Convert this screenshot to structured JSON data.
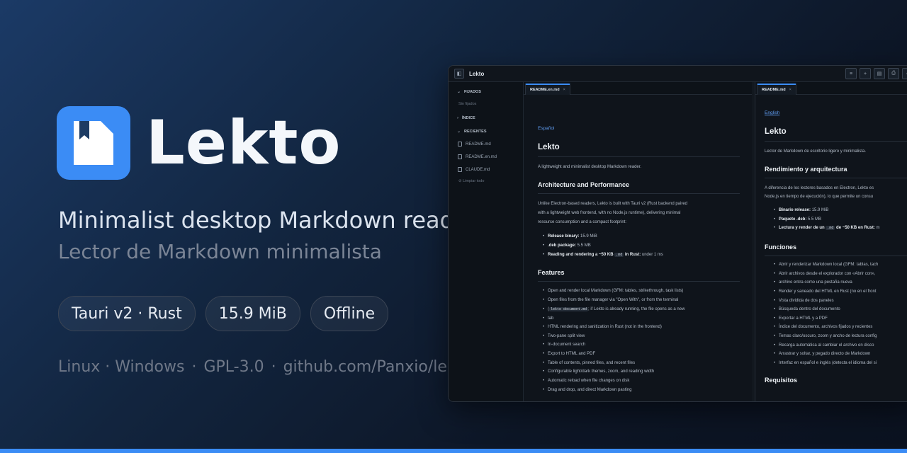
{
  "hero": {
    "app_name": "Lekto",
    "tagline_en": "Minimalist desktop Markdown reader",
    "tagline_es": "Lector de Markdown minimalista",
    "badges": [
      "Tauri v2 · Rust",
      "15.9 MiB",
      "Offline"
    ],
    "footer": {
      "platforms": "Linux · Windows",
      "license": "GPL-3.0",
      "repo": "github.com/Panxio/lekto"
    }
  },
  "window": {
    "title": "Lekto",
    "sidebar": {
      "pinned_label": "FIJADOS",
      "pinned_empty": "Sin fijados",
      "index_label": "ÍNDICE",
      "recent_label": "RECIENTES",
      "recent_files": [
        "README.md",
        "README.en.md",
        "CLAUDE.md"
      ],
      "clear_all": "Limpiar todo"
    },
    "pane_left": {
      "tab": "README.en.md",
      "lang_link": "Español",
      "h1": "Lekto",
      "intro": "A lightweight and minimalist desktop Markdown reader.",
      "h2_arch": "Architecture and Performance",
      "arch_p1": "Unlike Electron-based readers, Lekto is built with Tauri v2 (Rust backend paired",
      "arch_p2": "with a lightweight web frontend, with no Node.js runtime), delivering minimal",
      "arch_p3": "resource consumption and a compact footprint:",
      "stats": [
        {
          "label": "Release binary:",
          "value": " 15.9 MiB"
        },
        {
          "label": ".deb package:",
          "value": " 5.5 MB"
        },
        {
          "label": "Reading and rendering a ~50 KB ",
          "code": ".md",
          "label2": " in Rust:",
          "value": " under 1 ms"
        }
      ],
      "h2_features": "Features",
      "features": [
        "Open and render local Markdown (GFM: tables, strikethrough, task lists)",
        "Open files from the file manager via \"Open With\", or from the terminal",
        "HTML rendering and sanitization in Rust (not in the frontend)",
        "Two-pane split view",
        "In-document search",
        "Export to HTML and PDF",
        "Table of contents, pinned files, and recent files",
        "Configurable light/dark themes, zoom, and reading width",
        "Automatic reload when file changes on disk",
        "Drag and drop, and direct Markdown pasting"
      ],
      "feature2_code": "lekto document.md",
      "feature2_tail": "; if Lekto is already running, the file opens as a new",
      "feature2_wrap": "tab"
    },
    "pane_right": {
      "tab": "README.md",
      "lang_link": "English",
      "h1": "Lekto",
      "intro": "Lector de Markdown de escritorio ligero y minimalista.",
      "h2_arch": "Rendimiento y arquitectura",
      "arch_p1": "A diferencia de los lectores basados en Electron, Lekto es",
      "arch_p2": "Node.js en tiempo de ejecución), lo que permite un consu",
      "stats": [
        {
          "label": "Binario release:",
          "value": " 15.9 MiB"
        },
        {
          "label": "Paquete .deb:",
          "value": " 5.5 MB"
        },
        {
          "label": "Lectura y render de un ",
          "code": ".md",
          "label2": " de ~50 KB en Rust:",
          "value": " m"
        }
      ],
      "h2_features": "Funciones",
      "features": [
        "Abrir y renderizar Markdown local (GFM: tablas, tach",
        "Abrir archivos desde el explorador con «Abrir con»,",
        "archivo entra como una pestaña nueva",
        "Render y saneado del HTML en Rust (no en el front",
        "Vista dividida de dos paneles",
        "Búsqueda dentro del documento",
        "Exportar a HTML y a PDF",
        "Índice del documento, archivos fijados y recientes",
        "Temas claro/oscuro, zoom y ancho de lectura config",
        "Recarga automática al cambiar el archivo en disco",
        "Arrastrar y soltar, y pegado directo de Markdown",
        "Interfaz en español e inglés (detecta el idioma del si"
      ],
      "h2_req": "Requisitos"
    }
  },
  "colors": {
    "accent": "#3b8cf5",
    "bg": "#0d1626"
  }
}
